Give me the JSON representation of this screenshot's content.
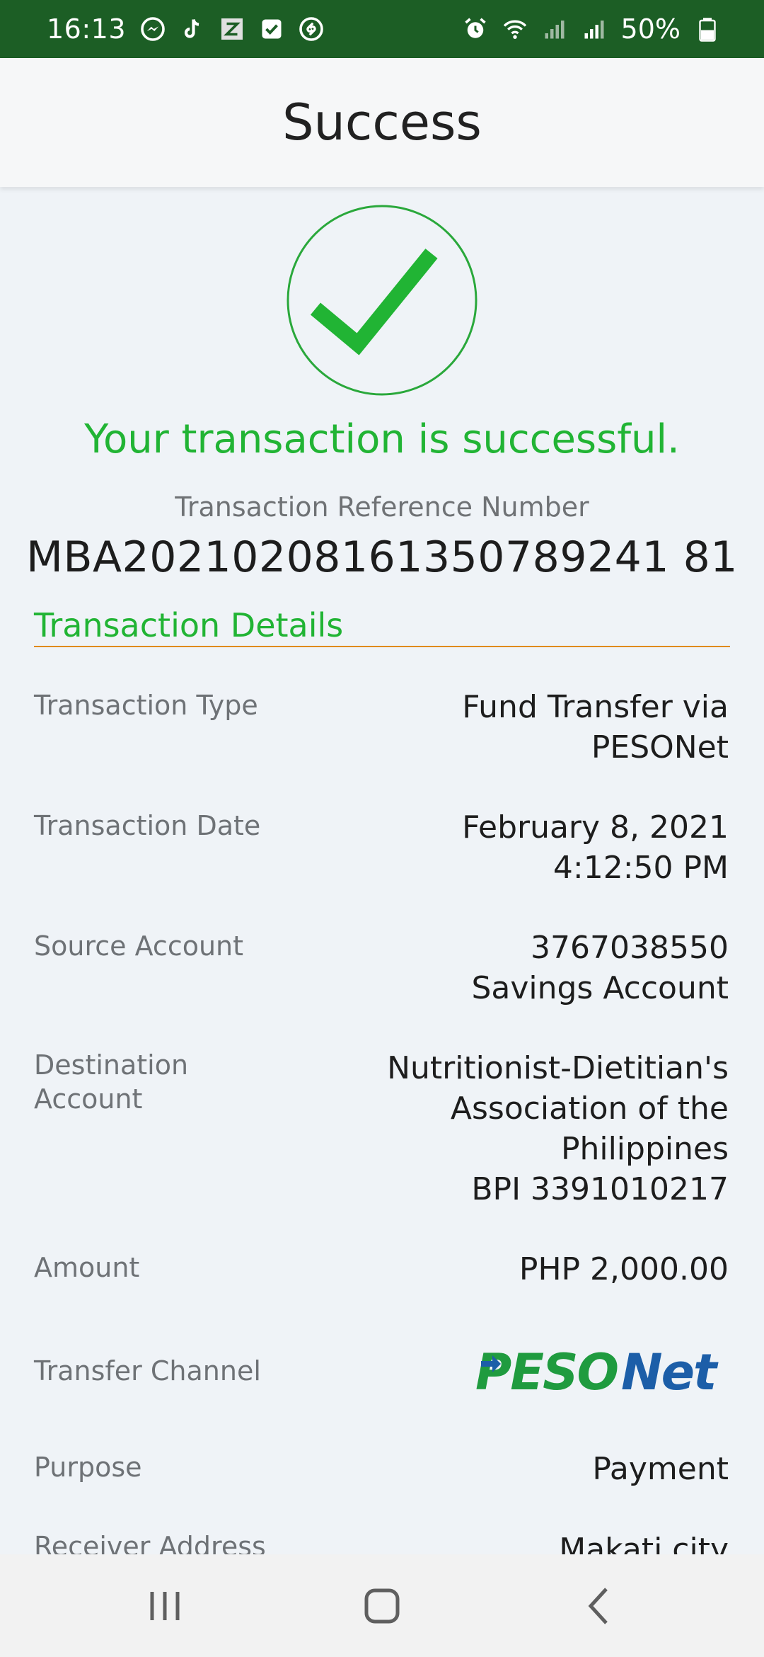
{
  "status_bar": {
    "time": "16:13",
    "notification_icons": [
      "messenger-icon",
      "tiktok-icon",
      "z-app-icon",
      "checkbox-app-icon",
      "shazam-icon"
    ],
    "system_icons": [
      "alarm-icon",
      "wifi-icon",
      "signal-icon",
      "signal-icon",
      "battery-icon"
    ],
    "battery": "50%",
    "background_color": "#1c5e25"
  },
  "header": {
    "title": "Success"
  },
  "result": {
    "message": "Your transaction is successful.",
    "reference_label": "Transaction Reference Number",
    "reference_number": "MBA20210208161350789241 81",
    "accent_color": "#21b434"
  },
  "details": {
    "section_title": "Transaction Details",
    "rule_color": "#e08a1b",
    "transaction_type": {
      "label": "Transaction Type",
      "value": "Fund Transfer via PESONet"
    },
    "transaction_date": {
      "label": "Transaction Date",
      "value": "February 8, 2021 4:12:50 PM"
    },
    "source_account": {
      "label": "Source Account",
      "value_line1": "3767038550",
      "value_line2": "Savings Account"
    },
    "destination_account": {
      "label": "Destination Account",
      "value_line1": "Nutritionist-Dietitian's Association of the Philippines",
      "value_line2": "BPI 3391010217"
    },
    "amount": {
      "label": "Amount",
      "value": "PHP 2,000.00"
    },
    "transfer_channel": {
      "label": "Transfer Channel",
      "logo": "PESONet"
    },
    "purpose": {
      "label": "Purpose",
      "value": "Payment"
    },
    "receiver_address": {
      "label": "Receiver Address",
      "value": "Makati city"
    }
  },
  "nav_bar": [
    "recent-apps-icon",
    "home-icon",
    "back-icon"
  ]
}
